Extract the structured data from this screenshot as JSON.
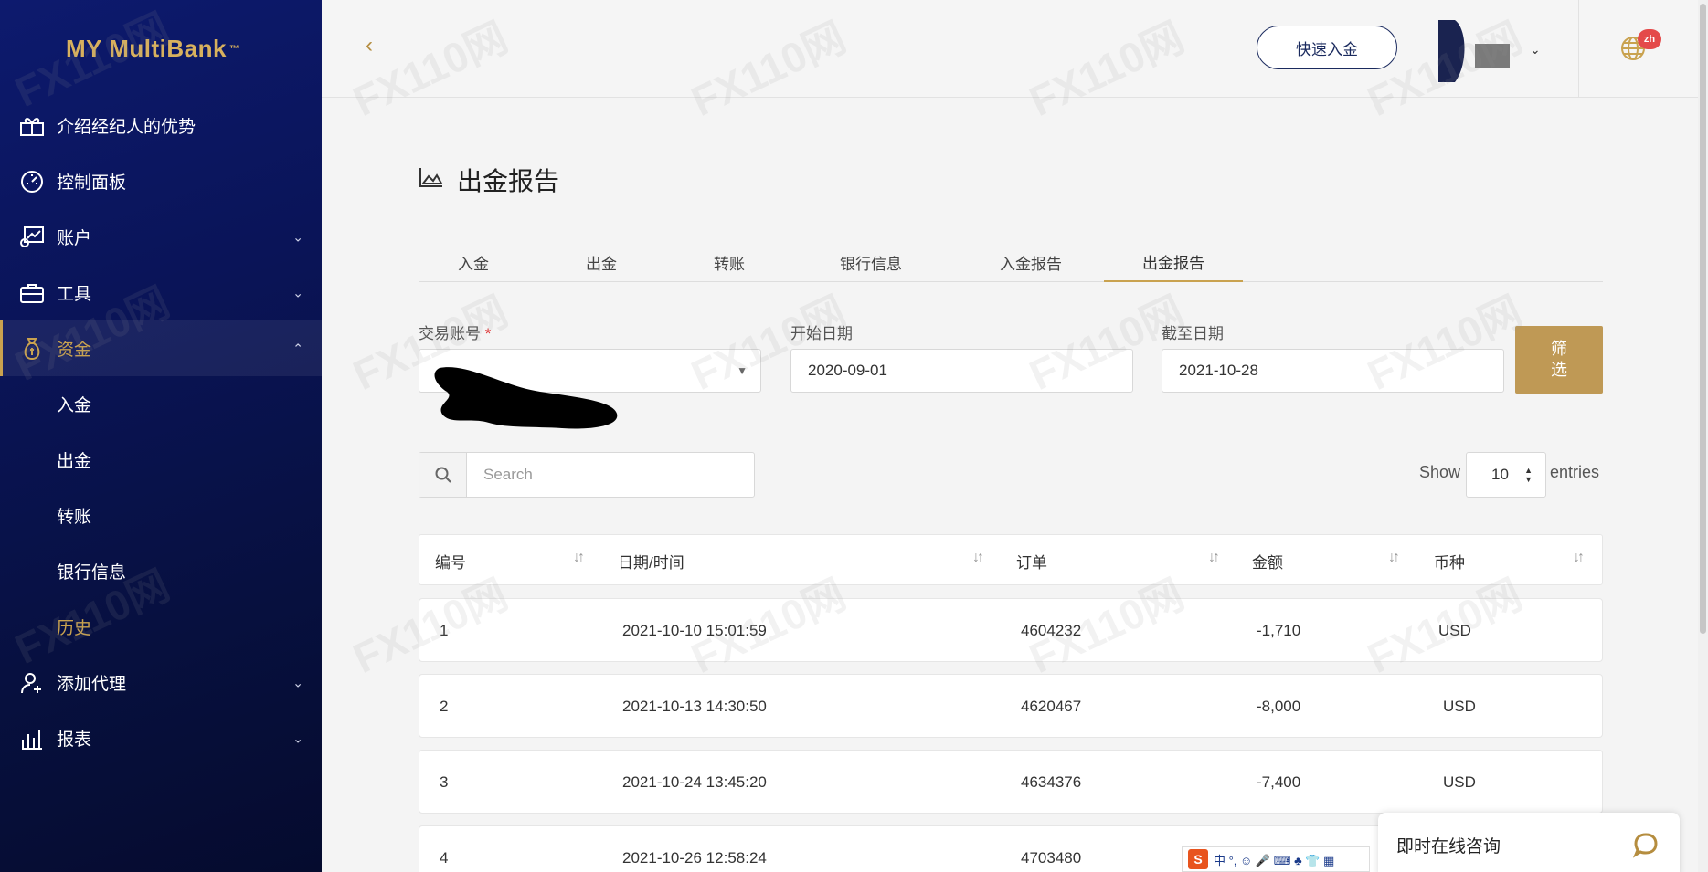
{
  "brand": {
    "logo_text": "MY MultiBank",
    "logo_mark": "™"
  },
  "sidebar": {
    "items": [
      {
        "label": "介绍经纪人的优势",
        "icon": "gift-icon",
        "has_chevron": false
      },
      {
        "label": "控制面板",
        "icon": "dashboard-icon",
        "has_chevron": false
      },
      {
        "label": "账户",
        "icon": "account-chart-icon",
        "has_chevron": true,
        "chevron": "⌄"
      },
      {
        "label": "工具",
        "icon": "briefcase-icon",
        "has_chevron": true,
        "chevron": "⌄"
      },
      {
        "label": "资金",
        "icon": "money-bag-icon",
        "has_chevron": true,
        "chevron": "⌃",
        "active": true
      }
    ],
    "sub_items": [
      {
        "label": "入金"
      },
      {
        "label": "出金"
      },
      {
        "label": "转账"
      },
      {
        "label": "银行信息"
      },
      {
        "label": "历史",
        "current": true
      }
    ],
    "items_after": [
      {
        "label": "添加代理",
        "icon": "add-agent-icon",
        "chevron": "⌄"
      },
      {
        "label": "报表",
        "icon": "report-chart-icon",
        "chevron": "⌄"
      }
    ]
  },
  "topbar": {
    "back_icon": "‹",
    "quick_deposit_label": "快速入金",
    "user_caret": "⌄",
    "language_badge": "zh"
  },
  "page": {
    "title": "出金报告",
    "tabs": [
      {
        "label": "入金"
      },
      {
        "label": "出金"
      },
      {
        "label": "转账"
      },
      {
        "label": "银行信息"
      },
      {
        "label": "入金报告"
      },
      {
        "label": "出金报告",
        "active": true
      }
    ],
    "filters": {
      "account_label": "交易账号",
      "required_mark": "*",
      "start_label": "开始日期",
      "start_value": "2020-09-01",
      "end_label": "截至日期",
      "end_value": "2021-10-28",
      "filter_button_line1": "筛",
      "filter_button_line2": "选"
    },
    "search": {
      "placeholder": "Search"
    },
    "entries": {
      "show_label": "Show",
      "value": "10",
      "entries_label": "entries"
    }
  },
  "table": {
    "columns": [
      "编号",
      "日期/时间",
      "订单",
      "金额",
      "币种"
    ],
    "rows": [
      {
        "id": "1",
        "datetime": "2021-10-10 15:01:59",
        "order": "4604232",
        "amount": "-1,710",
        "currency": "USD"
      },
      {
        "id": "2",
        "datetime": "2021-10-13 14:30:50",
        "order": "4620467",
        "amount": "-8,000",
        "currency": "USD"
      },
      {
        "id": "3",
        "datetime": "2021-10-24 13:45:20",
        "order": "4634376",
        "amount": "-7,400",
        "currency": "USD"
      },
      {
        "id": "4",
        "datetime": "2021-10-26 12:58:24",
        "order": "4703480",
        "amount": "",
        "currency": ""
      }
    ]
  },
  "ime_toolbar": {
    "brand": "S",
    "text": "中 °, ☺ 🎤 ⌨ ♣ 👕 ▦"
  },
  "chat": {
    "label": "即时在线咨询"
  },
  "watermark": "FX110网",
  "colors": {
    "sidebar_bg": "#0a1458",
    "accent_gold": "#c9a24f",
    "filter_button": "#bf9955",
    "badge_red": "#e44a4a"
  }
}
